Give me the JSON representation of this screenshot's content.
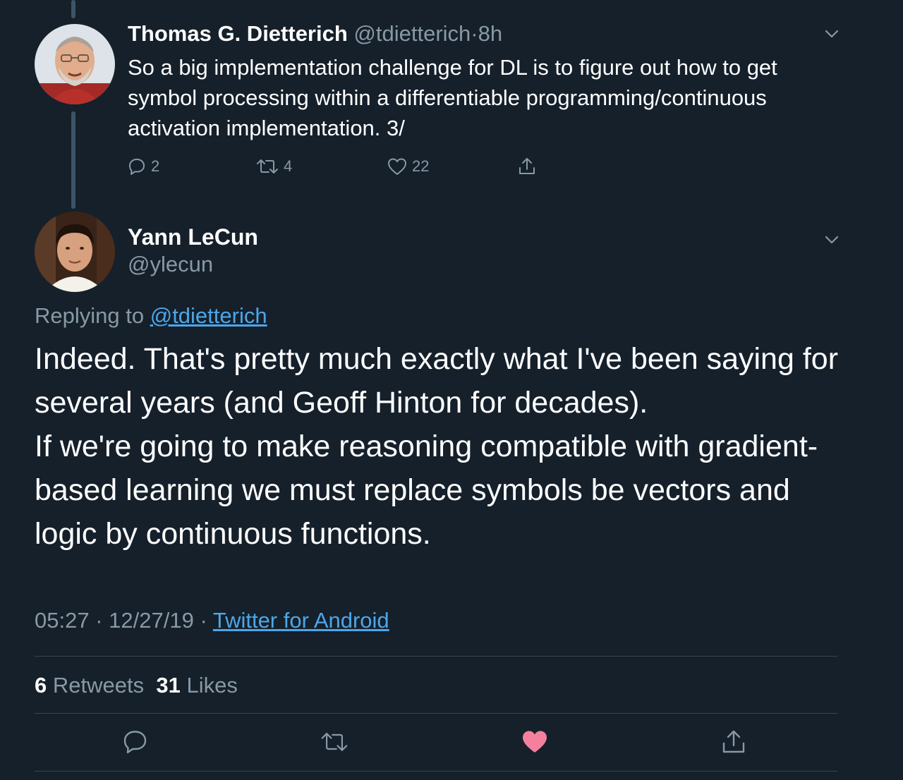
{
  "parent": {
    "name": "Thomas G. Dietterich",
    "handle": "@tdietterich",
    "separator": "·",
    "time": "8h",
    "text": "So a big implementation challenge for DL is to figure out how to get symbol processing within a differentiable programming/continuous activation implementation. 3/",
    "reply_count": "2",
    "retweet_count": "4",
    "like_count": "22"
  },
  "tweet": {
    "name": "Yann LeCun",
    "handle": "@ylecun",
    "replying_label": "Replying to",
    "replying_handle": "@tdietterich",
    "paragraph1": "Indeed. That's pretty much exactly what I've been saying for several years (and Geoff Hinton for decades).",
    "paragraph2": "If we're going to make reasoning compatible with gradient-based learning we must replace symbols be vectors and logic by continuous functions.",
    "time": "05:27",
    "date": "12/27/19",
    "separator": "·",
    "source": "Twitter for Android",
    "retweets_count": "6",
    "retweets_label": "Retweets",
    "likes_count": "31",
    "likes_label": "Likes"
  },
  "colors": {
    "background": "#15202b",
    "text": "#ffffff",
    "muted": "#8899a6",
    "link": "#4da6e8",
    "like_active": "#e0245e",
    "divider": "#38444d"
  },
  "icons": {
    "reply": "reply-icon",
    "retweet": "retweet-icon",
    "like": "heart-icon",
    "share": "share-icon",
    "menu": "chevron-down-icon"
  }
}
